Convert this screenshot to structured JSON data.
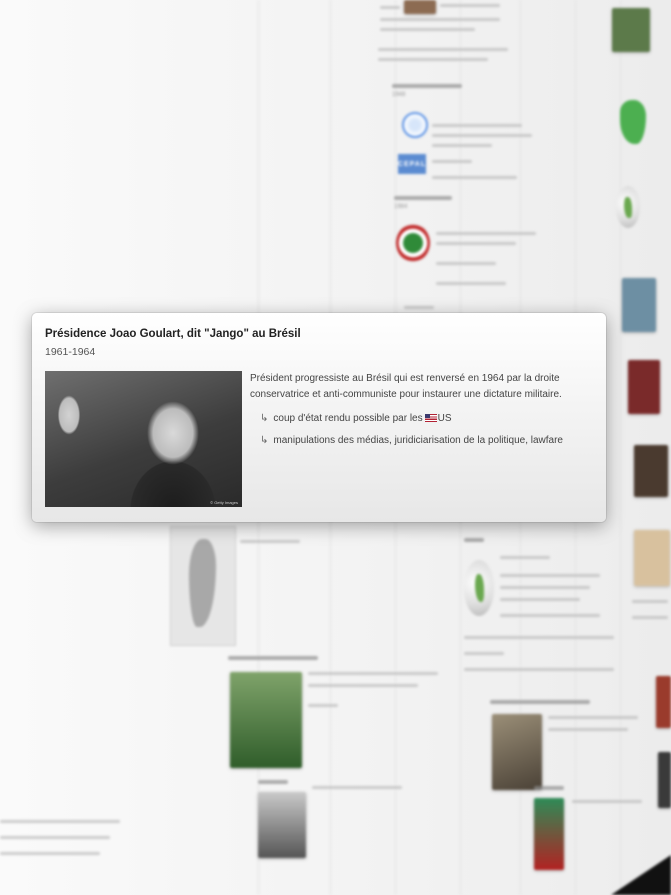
{
  "card": {
    "title": "Présidence Joao Goulart, dit \"Jango\" au Brésil",
    "period": "1961-1964",
    "photo_credit": "© Getty Images",
    "description": "Président progressiste au Brésil qui est renversé en 1964 par la droite conservatrice et anti-communiste pour instaurer une dictature militaire.",
    "sub_items": [
      {
        "arrow": "↳",
        "text_before": "coup d'état rendu possible par les",
        "flag_icon": "us-flag-icon",
        "text_after": "US"
      },
      {
        "arrow": "↳",
        "text": "manipulations des médias, juridiciarisation de la politique, lawfare"
      }
    ]
  },
  "background": {
    "cepal_logo": "CEPAL",
    "items": [
      "CEPAL",
      "Mouvement des sans-terre",
      "Révolution cubaine"
    ]
  }
}
